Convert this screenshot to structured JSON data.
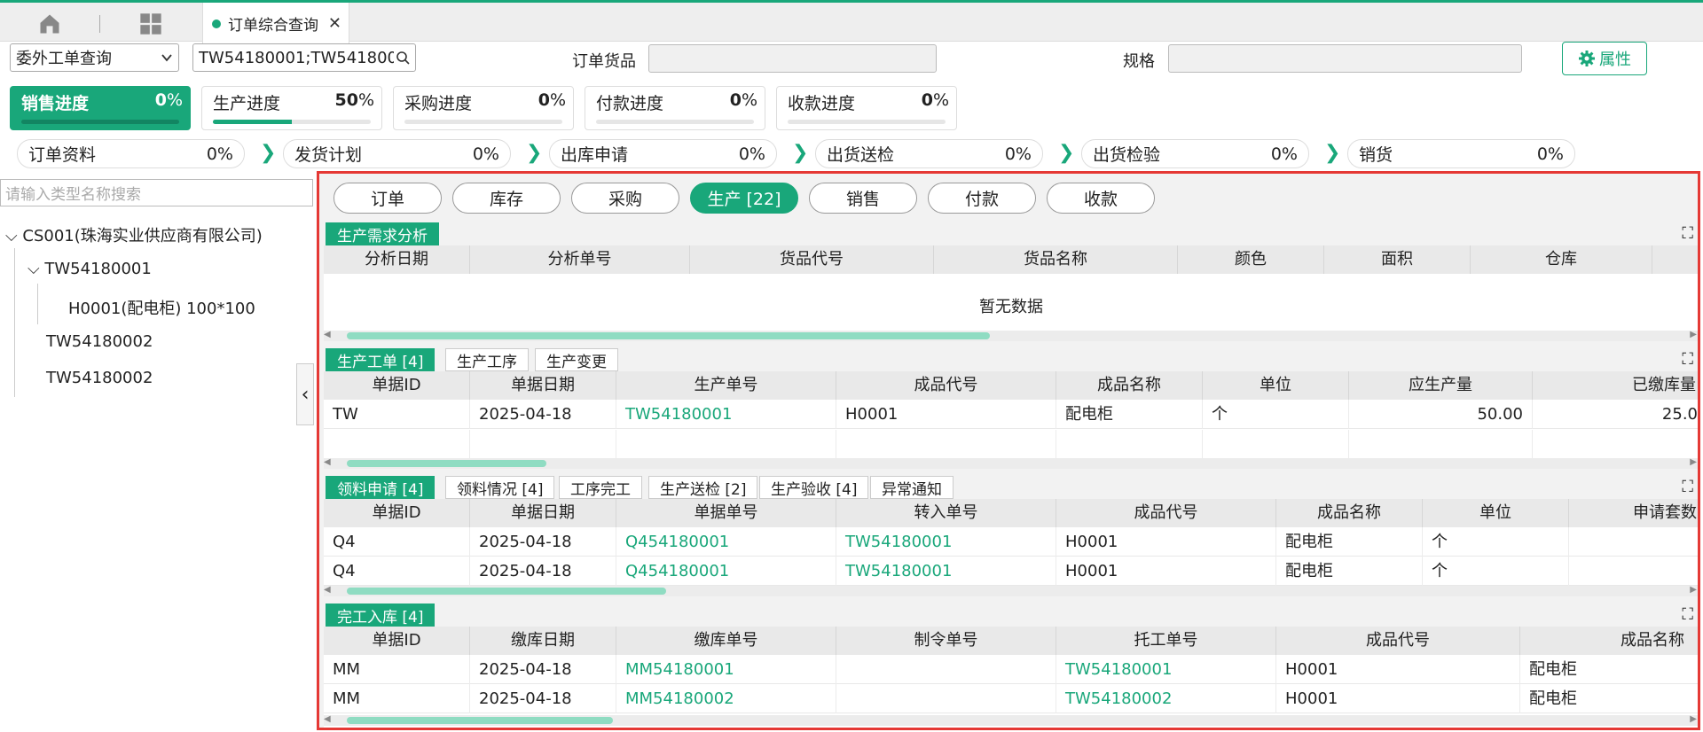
{
  "tabbar": {
    "home_icon": "home-icon",
    "grid_icon": "grid-icon",
    "doc_tab": "订单综合查询",
    "close": "✕"
  },
  "search": {
    "type_select": "委外工单查询",
    "query": "TW54180001;TW5418000(",
    "goods_label": "订单货品",
    "spec_label": "规格",
    "property_button": "属性"
  },
  "progress": [
    {
      "name": "销售进度",
      "value": "0",
      "unit": "%",
      "fraction": 0.0
    },
    {
      "name": "生产进度",
      "value": "50",
      "unit": "%",
      "fraction": 0.5
    },
    {
      "name": "采购进度",
      "value": "0",
      "unit": "%",
      "fraction": 0.0
    },
    {
      "name": "付款进度",
      "value": "0",
      "unit": "%",
      "fraction": 0.0
    },
    {
      "name": "收款进度",
      "value": "0",
      "unit": "%",
      "fraction": 0.0
    }
  ],
  "steps": [
    {
      "name": "订单资料",
      "pct": "0%"
    },
    {
      "name": "发货计划",
      "pct": "0%"
    },
    {
      "name": "出库申请",
      "pct": "0%"
    },
    {
      "name": "出货送检",
      "pct": "0%"
    },
    {
      "name": "出货检验",
      "pct": "0%"
    },
    {
      "name": "销货",
      "pct": "0%"
    }
  ],
  "tree": {
    "search_placeholder": "请输入类型名称搜索",
    "items": [
      "CS001(珠海实业供应商有限公司)",
      "TW54180001",
      "H0001(配电柜) 100*100",
      "TW54180002",
      "TW54180002"
    ]
  },
  "pills": [
    "订单",
    "库存",
    "采购",
    "生产 [22]",
    "销售",
    "付款",
    "收款"
  ],
  "sec1": {
    "tab": "生产需求分析",
    "cols": [
      "分析日期",
      "分析单号",
      "货品代号",
      "货品名称",
      "颜色",
      "面积",
      "仓库"
    ],
    "empty": "暂无数据"
  },
  "sec2": {
    "tabs": [
      "生产工单 [4]",
      "生产工序",
      "生产变更"
    ],
    "cols": [
      "单据ID",
      "单据日期",
      "生产单号",
      "成品代号",
      "成品名称",
      "单位",
      "应生产量",
      "已缴库量"
    ],
    "rows": [
      [
        "TW",
        "2025-04-18",
        "TW54180001",
        "H0001",
        "配电柜",
        "个",
        "50.00",
        "25.0"
      ]
    ]
  },
  "sec3": {
    "tabs": [
      "领料申请 [4]",
      "领料情况 [4]",
      "工序完工",
      "生产送检 [2]",
      "生产验收 [4]",
      "异常通知"
    ],
    "cols": [
      "单据ID",
      "单据日期",
      "单据单号",
      "转入单号",
      "成品代号",
      "成品名称",
      "单位",
      "申请套数"
    ],
    "rows": [
      [
        "Q4",
        "2025-04-18",
        "Q454180001",
        "TW54180001",
        "H0001",
        "配电柜",
        "个",
        ""
      ],
      [
        "Q4",
        "2025-04-18",
        "Q454180001",
        "TW54180001",
        "H0001",
        "配电柜",
        "个",
        ""
      ]
    ]
  },
  "sec4": {
    "tab": "完工入库 [4]",
    "cols": [
      "单据ID",
      "缴库日期",
      "缴库单号",
      "制令单号",
      "托工单号",
      "成品代号",
      "成品名称"
    ],
    "rows": [
      [
        "MM",
        "2025-04-18",
        "MM54180001",
        "",
        "TW54180001",
        "H0001",
        "配电柜"
      ],
      [
        "MM",
        "2025-04-18",
        "MM54180002",
        "",
        "TW54180002",
        "H0001",
        "配电柜"
      ]
    ]
  }
}
